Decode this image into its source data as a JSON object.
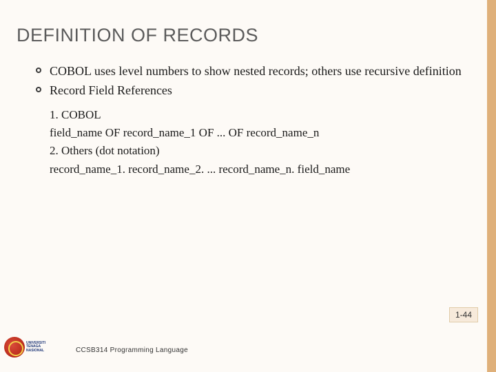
{
  "title": "DEFINITION OF RECORDS",
  "bullets": [
    "COBOL uses level numbers to show nested records; others use recursive definition",
    "Record Field References"
  ],
  "sub_lines": [
    "1. COBOL",
    "field_name OF record_name_1 OF ... OF record_name_n",
    "2. Others (dot notation)",
    "record_name_1. record_name_2. ... record_name_n. field_name"
  ],
  "page_number": "1-44",
  "footer": "CCSB314 Programming Language",
  "logo_text": "UNIVERSITI\nTENAGA\nNASIONAL"
}
